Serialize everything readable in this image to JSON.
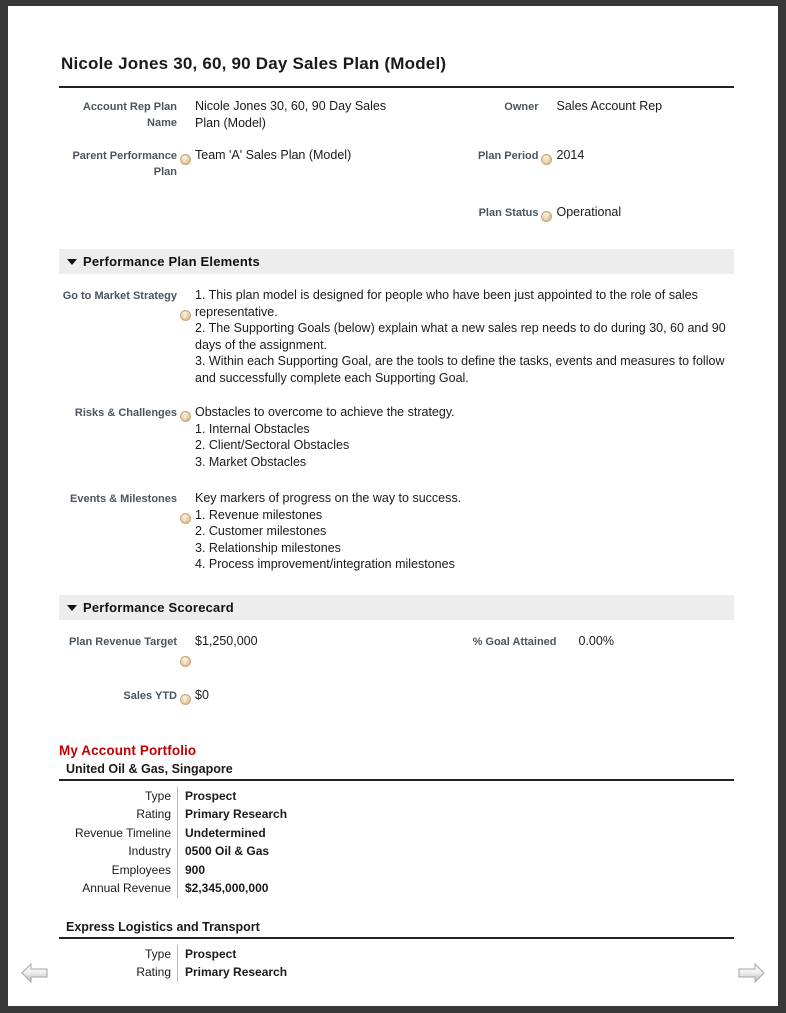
{
  "document": {
    "title": "Nicole Jones 30, 60, 90 Day Sales Plan (Model)"
  },
  "header_fields": {
    "account_rep_plan_name": {
      "label": "Account Rep Plan Name",
      "value_line1": "Nicole Jones 30, 60, 90 Day Sales",
      "value_line2": "Plan (Model)",
      "has_help": false
    },
    "parent_performance_plan": {
      "label": "Parent Performance Plan",
      "value": "Team 'A' Sales Plan (Model)",
      "has_help": true
    },
    "owner": {
      "label": "Owner",
      "value": "Sales Account Rep",
      "has_help": false
    },
    "plan_period": {
      "label": "Plan Period",
      "value": "2014",
      "has_help": true
    },
    "plan_status": {
      "label": "Plan Status",
      "value": "Operational",
      "has_help": true
    }
  },
  "sections": {
    "plan_elements": {
      "title": "Performance Plan Elements",
      "toggle": "collapse-triangle",
      "go_to_market": {
        "label": "Go to Market Strategy",
        "has_help": true,
        "lines": [
          "1. This plan model is designed for people who have been just appointed to the role of sales",
          "representative.",
          "2. The Supporting Goals (below) explain what a new sales rep needs to do during 30, 60 and 90",
          "days of the assignment.",
          "3. Within each Supporting Goal, are the tools to define the tasks, events and measures to follow",
          "and successfully complete each Supporting Goal."
        ]
      },
      "risks_challenges": {
        "label": "Risks & Challenges",
        "has_help": true,
        "lines": [
          "Obstacles to overcome to achieve the strategy.",
          "1. Internal Obstacles",
          "2. Client/Sectoral Obstacles",
          "3. Market Obstacles"
        ]
      },
      "events_milestones": {
        "label": "Events & Milestones",
        "has_help": true,
        "lines": [
          "Key markers of progress on the way to success.",
          "1. Revenue milestones",
          "2. Customer milestones",
          "3. Relationship milestones",
          "4. Process improvement/integration milestones"
        ]
      }
    },
    "scorecard": {
      "title": "Performance Scorecard",
      "toggle": "collapse-triangle",
      "plan_revenue_target": {
        "label": "Plan Revenue Target",
        "value": "$1,250,000",
        "has_help": true
      },
      "sales_ytd": {
        "label": "Sales YTD",
        "value": "$0",
        "has_help": true
      },
      "goal_attained": {
        "label": "% Goal Attained",
        "value": "0.00%",
        "has_help": false
      }
    }
  },
  "related_list": {
    "title": "My Account Portfolio",
    "accounts": [
      {
        "name": "United Oil & Gas, Singapore",
        "fields": [
          {
            "label": "Type",
            "value": "Prospect"
          },
          {
            "label": "Rating",
            "value": "Primary Research"
          },
          {
            "label": "Revenue Timeline",
            "value": "Undetermined"
          },
          {
            "label": "Industry",
            "value": "0500 Oil & Gas"
          },
          {
            "label": "Employees",
            "value": "900"
          },
          {
            "label": "Annual Revenue",
            "value": "$2,345,000,000"
          }
        ]
      },
      {
        "name": "Express Logistics and Transport",
        "fields": [
          {
            "label": "Type",
            "value": "Prospect"
          },
          {
            "label": "Rating",
            "value": "Primary Research"
          }
        ]
      }
    ]
  },
  "navigation": {
    "prev_label": "previous-page",
    "next_label": "next-page"
  },
  "colors": {
    "frame": "#373737",
    "page": "#ffffff",
    "section_bar": "#ededed",
    "label": "#4a5560",
    "related_list_title": "#c00000",
    "rule": "#222222"
  }
}
